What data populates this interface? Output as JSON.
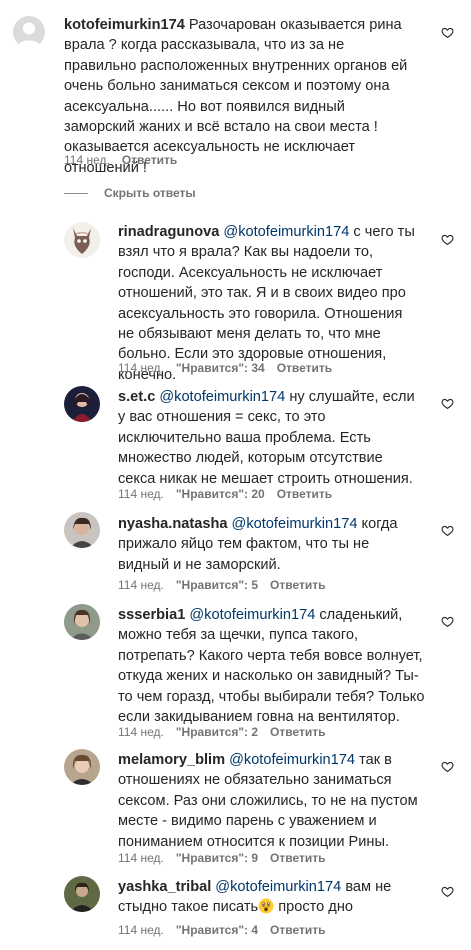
{
  "main_comment": {
    "username": "kotofeimurkin174",
    "text": "Разочарован оказывается рина врала ? когда рассказывала, что из за не правильно расположенных внутренних органов ей очень больно заниматься сексом и поэтому она асексуальна...... Но вот появился видный заморский жаних и всё встало на свои места ! оказывается асексуальность не исключает отношений !",
    "time": "114 нед.",
    "reply": "Ответить"
  },
  "hide_replies_label": "Скрыть ответы",
  "replies": [
    {
      "username": "rinadragunova",
      "mention": "@kotofeimurkin174",
      "text": "с чего ты взял что я врала? Как вы надоели то, господи. Асексуальность не исключает отношений, это так. Я и в своих видео про асексуальность это говорила. Отношения не обязывают меня делать то, что мне больно. Если это здоровые отношения, конечно.",
      "time": "114 нед.",
      "likes": "\"Нравится\": 34",
      "reply": "Ответить"
    },
    {
      "username": "s.et.c",
      "mention": "@kotofeimurkin174",
      "text": "ну слушайте, если у вас отношения = секс, то это исключительно ваша проблема. Есть множество людей, которым отсутствие секса никак не мешает строить отношения.",
      "time": "114 нед.",
      "likes": "\"Нравится\": 20",
      "reply": "Ответить"
    },
    {
      "username": "nyasha.natasha",
      "mention": "@kotofeimurkin174",
      "text": "когда прижало яйцо тем фактом, что ты не видный и не заморский.",
      "time": "114 нед.",
      "likes": "\"Нравится\": 5",
      "reply": "Ответить"
    },
    {
      "username": "ssserbia1",
      "mention": "@kotofeimurkin174",
      "text": "сладенький, можно тебя за щечки, пупса такого, потрепать? Какого черта тебя вовсе волнует, откуда жених и насколько он завидный? Ты-то чем горазд, чтобы выбирали тебя? Только если закидыванием говна на вентилятор.",
      "time": "114 нед.",
      "likes": "\"Нравится\": 2",
      "reply": "Ответить"
    },
    {
      "username": "melamory_blim",
      "mention": "@kotofeimurkin174",
      "text": "так в отношениях не обязательно заниматься сексом. Раз они сложились, то не на пустом месте - видимо парень с уважением и пониманием относится к позиции Рины.",
      "time": "114 нед.",
      "likes": "\"Нравится\": 9",
      "reply": "Ответить"
    },
    {
      "username": "yashka_tribal",
      "mention": "@kotofeimurkin174",
      "text": "вам не стыдно такое писать",
      "text_after": "просто дно",
      "time": "114 нед.",
      "likes": "\"Нравится\": 4",
      "reply": "Ответить"
    }
  ],
  "icons": {
    "heart": "heart-outline-icon",
    "emoji": "astonished-face-emoji"
  },
  "colors": {
    "text": "#262626",
    "meta": "#737373",
    "mention": "#00376b"
  }
}
